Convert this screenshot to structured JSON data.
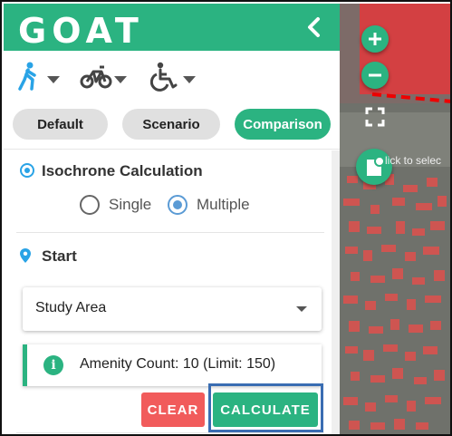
{
  "app": {
    "logo_text": "GOAT"
  },
  "header": {
    "collapse_icon": "chevron-left-icon"
  },
  "modes": [
    {
      "name": "walking",
      "icon": "walk-icon",
      "active": true
    },
    {
      "name": "bicycle",
      "icon": "bicycle-icon",
      "active": false
    },
    {
      "name": "wheelchair",
      "icon": "wheelchair-icon",
      "active": false
    }
  ],
  "tabs": [
    {
      "label": "Default",
      "active": false
    },
    {
      "label": "Scenario",
      "active": false
    },
    {
      "label": "Comparison",
      "active": true
    }
  ],
  "isochrone": {
    "title": "Isochrone Calculation",
    "options": [
      {
        "label": "Single",
        "checked": false
      },
      {
        "label": "Multiple",
        "checked": true
      }
    ]
  },
  "start": {
    "title": "Start",
    "select_value": "Study Area"
  },
  "info": {
    "text": "Amenity Count: 10 (Limit: 150)"
  },
  "actions": {
    "clear_label": "CLEAR",
    "calculate_label": "CALCULATE"
  },
  "map": {
    "tooltip": "lick to selec"
  },
  "colors": {
    "accent": "#2bb381",
    "danger": "#f15b5b",
    "highlight": "#3a6db2",
    "building": "#d9534f",
    "radio": "#5b9bd5"
  }
}
